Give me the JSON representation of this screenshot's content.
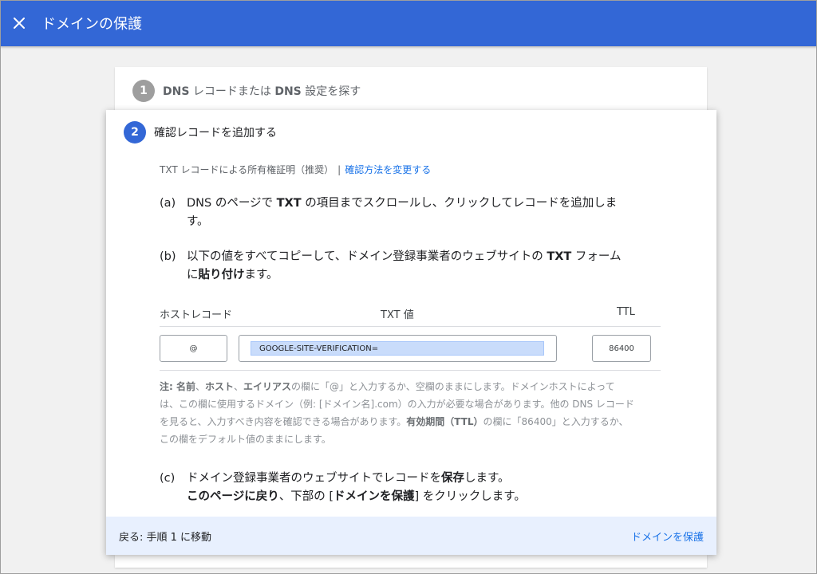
{
  "header": {
    "title": "ドメインの保護",
    "accent_color": "#3367d6"
  },
  "step1": {
    "number": "1",
    "title_part1": "DNS",
    "title_part2": " レコードまたは ",
    "title_part3": "DNS",
    "title_part4": " 設定を探す"
  },
  "step2": {
    "number": "2",
    "title": "確認レコードを追加する",
    "method_label": "TXT レコードによる所有権証明（推奨）",
    "method_separator": "|",
    "change_method_link": "確認方法を変更する",
    "instr_a": {
      "label": "(a)",
      "p1": "DNS のページで ",
      "b1": "TXT",
      "p2": " の項目までスクロールし、クリックしてレコードを追加しま",
      "p3": "す。"
    },
    "instr_b": {
      "label": "(b)",
      "p1": "以下の値をすべてコピーして、ドメイン登録事業者のウェブサイトの ",
      "b1": "TXT",
      "p2": " フォーム",
      "p3": "に",
      "b2": "貼り付け",
      "p4": "ます。"
    },
    "table": {
      "col_host": "ホストレコード",
      "col_txt": "TXT 値",
      "col_ttl": "TTL",
      "host_value": "@",
      "txt_value": "GOOGLE-SITE-VERIFICATION=",
      "ttl_value": "86400"
    },
    "note": {
      "b1": "注: 名前",
      "p1": "、",
      "b2": "ホスト",
      "p2": "、",
      "b3": "エイリアス",
      "p3": "の欄に「@」と入力するか、空欄のままにします。ドメインホストによって",
      "p4": "は、この欄に使用するドメイン（例: [ドメイン名].com）の入力が必要な場合があります。他の DNS レコード",
      "p5": "を見ると、入力すべき内容を確認できる場合があります。",
      "b4": "有効期間（TTL）",
      "p6": "の欄に「86400」と入力するか、",
      "p7": "この欄をデフォルト値のままにします。"
    },
    "instr_c": {
      "label": "(c)",
      "p1": "ドメイン登録事業者のウェブサイトでレコードを",
      "b1": "保存",
      "p2": "します。",
      "b2": "このページに戻り",
      "p3": "、下部の [",
      "b3": "ドメインを保護",
      "p4": "] をクリックします。"
    },
    "footer": {
      "back_label": "戻る: 手順 1 に移動",
      "protect_label": "ドメインを保護"
    }
  }
}
